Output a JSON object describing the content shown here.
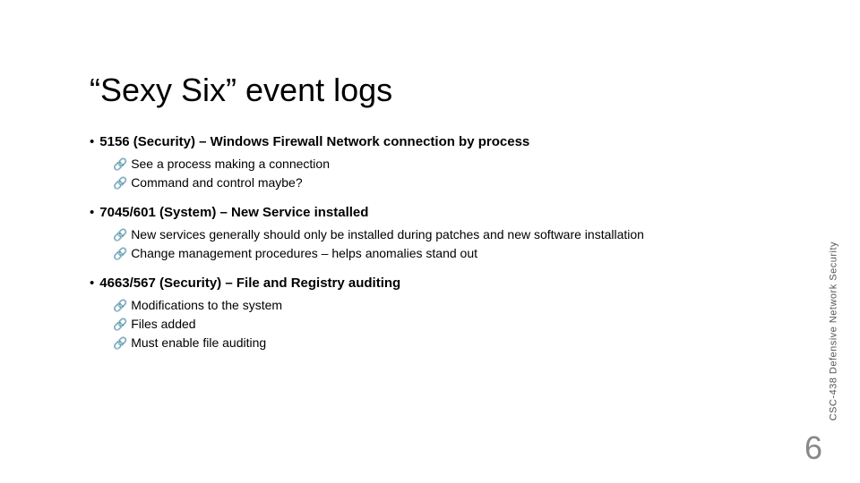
{
  "title": "“Sexy Six” event logs",
  "items": [
    {
      "heading": "5156 (Security) – Windows Firewall Network connection by process",
      "subs": [
        "See a process making a connection",
        "Command and control maybe?"
      ]
    },
    {
      "heading": "7045/601 (System) – New Service installed",
      "subs": [
        "New services generally should only be installed during patches and new software installation",
        "Change management procedures – helps anomalies stand out"
      ]
    },
    {
      "heading": "4663/567 (Security) – File and Registry auditing",
      "subs": [
        "Modifications to the system",
        "Files added",
        "Must enable file auditing"
      ]
    }
  ],
  "sidebar": "CSC-438 Defensive Network Security",
  "page_number": "6",
  "markers": {
    "dot": "•",
    "sub": "🔗"
  }
}
